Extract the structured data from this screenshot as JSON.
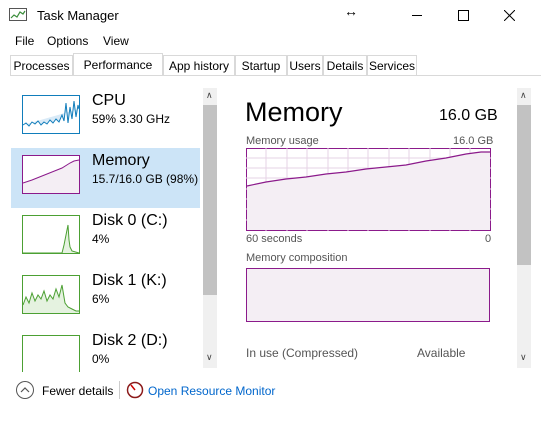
{
  "window": {
    "title": "Task Manager"
  },
  "menu": {
    "items": [
      "File",
      "Options",
      "View"
    ]
  },
  "tabs": [
    "Processes",
    "Performance",
    "App history",
    "Startup",
    "Users",
    "Details",
    "Services"
  ],
  "sidebar": {
    "items": [
      {
        "name": "CPU",
        "sub": "59%  3.30 GHz"
      },
      {
        "name": "Memory",
        "sub": "15.7/16.0 GB (98%)"
      },
      {
        "name": "Disk 0 (C:)",
        "sub": "4%"
      },
      {
        "name": "Disk 1 (K:)",
        "sub": "6%"
      },
      {
        "name": "Disk 2 (D:)",
        "sub": "0%"
      }
    ]
  },
  "main": {
    "title": "Memory",
    "total": "16.0 GB",
    "usage_label": "Memory usage",
    "usage_max": "16.0 GB",
    "time_left": "60 seconds",
    "time_right": "0",
    "composition_label": "Memory composition",
    "in_use_label": "In use (Compressed)",
    "available_label": "Available"
  },
  "footer": {
    "fewer_details": "Fewer details",
    "open_resource_monitor": "Open Resource Monitor"
  },
  "colors": {
    "memory": "#8b1a8b",
    "memory_fill": "#f4eef4",
    "disk": "#4ca033",
    "cpu": "#117dbb",
    "selected": "#cce4f7",
    "link": "#0066cc"
  },
  "icons": {
    "app": "task-manager-icon",
    "move": "move-arrows-icon",
    "minimize": "minimize-icon",
    "maximize": "maximize-icon",
    "close": "close-icon",
    "fewer": "chevron-up-circle-icon",
    "resource_monitor": "resource-monitor-icon"
  }
}
